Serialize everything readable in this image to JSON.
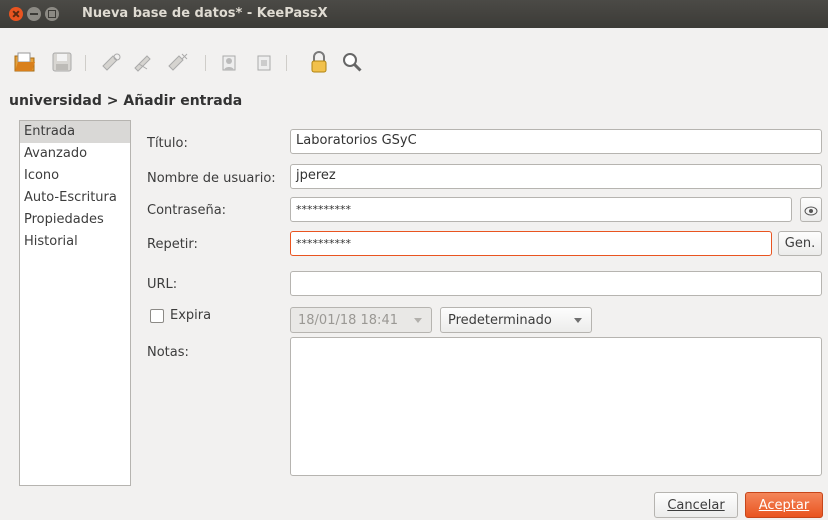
{
  "window": {
    "title": "Nueva base de datos* - KeePassX"
  },
  "toolbar": {
    "icons": [
      "open-database-icon",
      "save-database-icon",
      "add-entry-icon",
      "edit-entry-icon",
      "delete-entry-icon",
      "copy-username-icon",
      "copy-password-icon",
      "lock-icon",
      "search-icon"
    ]
  },
  "breadcrumb": "universidad > Añadir entrada",
  "sidebar": {
    "items": [
      {
        "label": "Entrada"
      },
      {
        "label": "Avanzado"
      },
      {
        "label": "Icono"
      },
      {
        "label": "Auto-Escritura"
      },
      {
        "label": "Propiedades"
      },
      {
        "label": "Historial"
      }
    ]
  },
  "form": {
    "title_label": "Título:",
    "title_value": "Laboratorios GSyC",
    "username_label": "Nombre de usuario:",
    "username_value": "jperez",
    "password_label": "Contraseña:",
    "password_value": "**********",
    "repeat_label": "Repetir:",
    "repeat_value": "**********",
    "gen_label": "Gen.",
    "url_label": "URL:",
    "url_value": "",
    "expires_label": "Expira",
    "expires_checked": false,
    "expiry_datetime": "18/01/18 18:41",
    "preset_value": "Predeterminado",
    "notes_label": "Notas:",
    "notes_value": ""
  },
  "buttons": {
    "cancel_label": "Cancelar",
    "accept_label": "Aceptar"
  },
  "colors": {
    "accent": "#e95420",
    "titlebar": "#3c3b37"
  }
}
